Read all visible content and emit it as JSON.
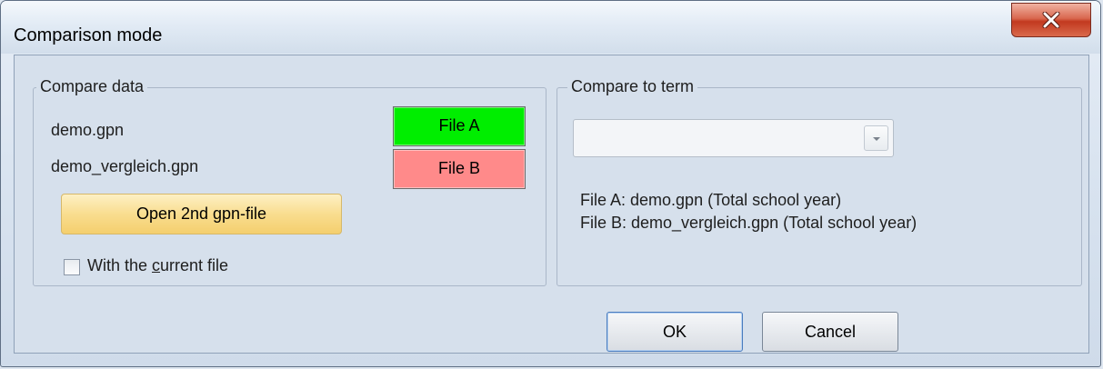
{
  "window": {
    "title": "Comparison mode",
    "close_icon": "close-x-icon"
  },
  "compare_data": {
    "legend": "Compare data",
    "file_a_name": "demo.gpn",
    "file_b_name": "demo_vergleich.gpn",
    "file_a_button": "File A",
    "file_b_button": "File B",
    "file_a_color": "#00ee00",
    "file_b_color": "#ff8a8a",
    "open_button": "Open 2nd gpn-file",
    "checkbox_label_pre": "With the ",
    "checkbox_label_underlined": "c",
    "checkbox_label_post": "urrent file",
    "checkbox_checked": false
  },
  "compare_to_term": {
    "legend": "Compare to term",
    "select_value": "",
    "info_line_a": "File A: demo.gpn (Total school year)",
    "info_line_b": "File B: demo_vergleich.gpn (Total school year)"
  },
  "footer": {
    "ok_label": "OK",
    "cancel_label": "Cancel"
  }
}
